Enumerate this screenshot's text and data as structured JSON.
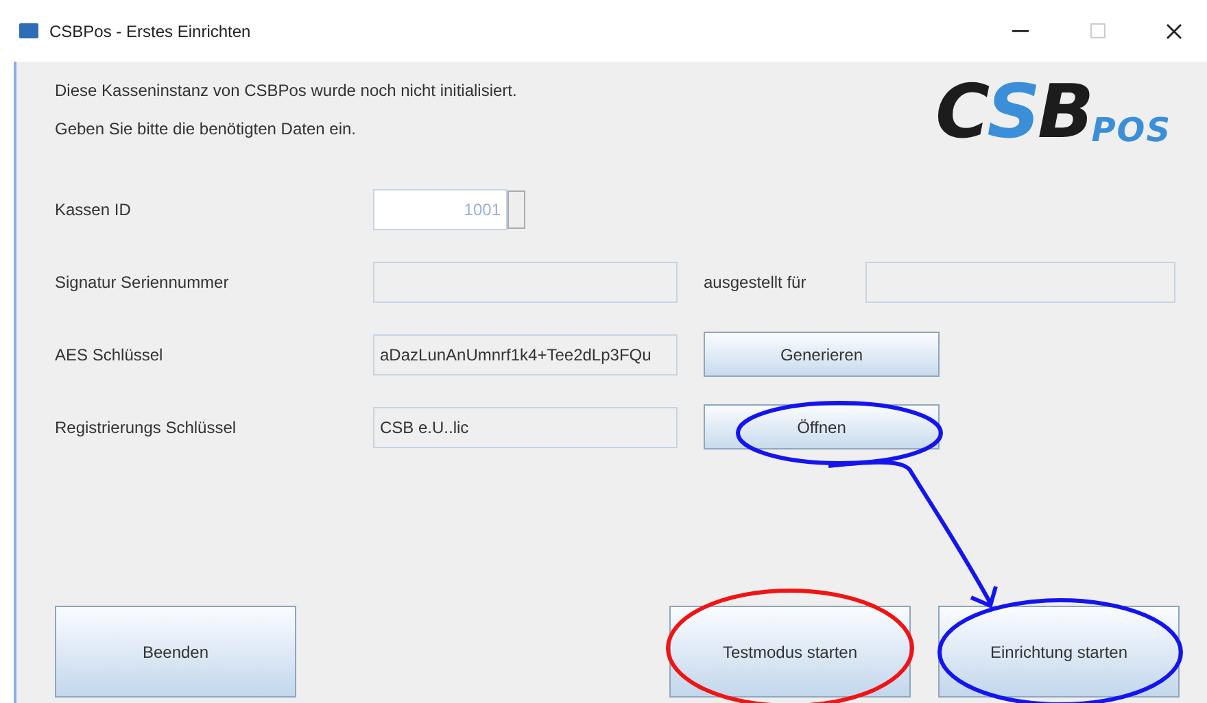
{
  "window": {
    "title": "CSBPos - Erstes Einrichten"
  },
  "intro": [
    "Diese Kasseninstanz von CSBPos wurde noch nicht initialisiert.",
    "Geben Sie bitte die benötigten Daten ein."
  ],
  "logo": {
    "letters": [
      {
        "text": "C",
        "color": "#1c1c1c"
      },
      {
        "text": "S",
        "color": "#3a8fd8"
      },
      {
        "text": "B",
        "color": "#1c1c1c"
      }
    ],
    "suffix": "POS"
  },
  "form": [
    {
      "kind": "spinner",
      "label": "Kassen ID",
      "value": "1001"
    },
    {
      "kind": "pair",
      "label": "Signatur Seriennummer",
      "label_2": "ausgestellt für"
    },
    {
      "kind": "button",
      "label": "AES Schlüssel",
      "value": "aDazLunAnUmnrf1k4+Tee2dLp3FQu",
      "button": "Generieren"
    },
    {
      "kind": "button",
      "label": "Registrierungs Schlüssel",
      "value": "CSB e.U..lic",
      "button": "Öffnen"
    }
  ],
  "buttons": [
    "Beenden",
    "Testmodus starten",
    "Einrichtung starten"
  ],
  "annotations": [
    {
      "kind": "ellipse",
      "color": "#1414f0"
    },
    {
      "kind": "arrow",
      "color": "#1414f0"
    },
    {
      "kind": "ellipse",
      "color": "#f01414"
    },
    {
      "kind": "ellipse",
      "color": "#1414f0"
    }
  ]
}
